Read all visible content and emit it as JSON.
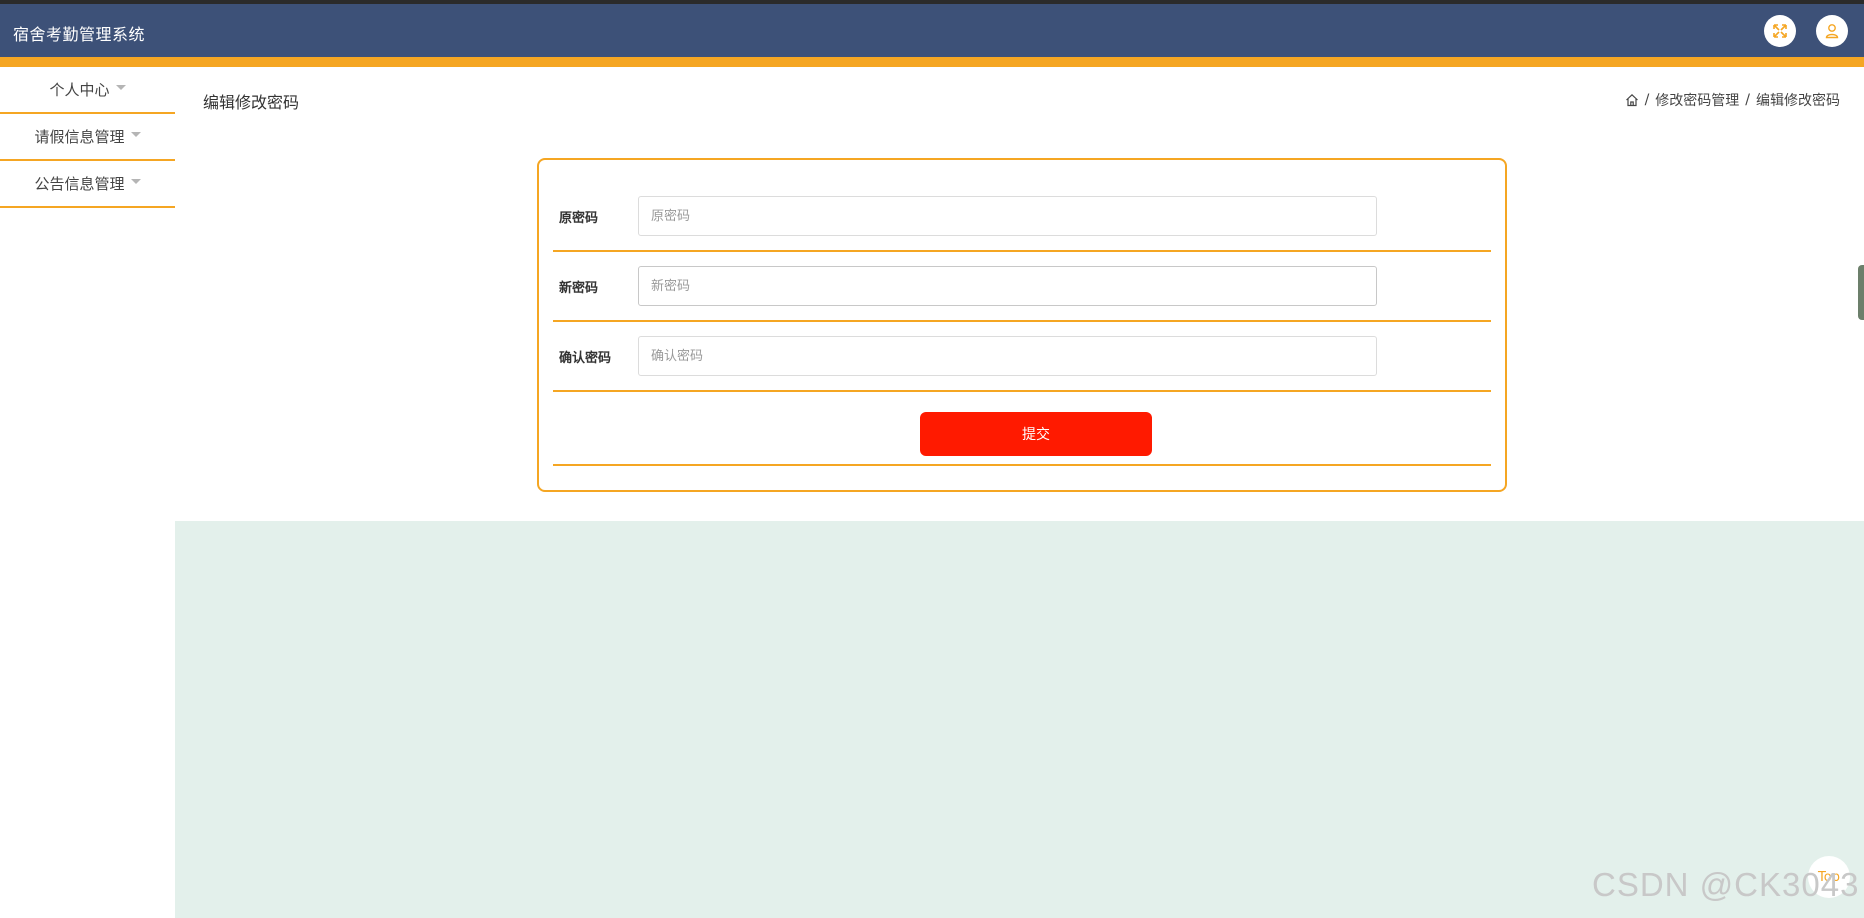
{
  "app": {
    "title": "宿舍考勤管理系统"
  },
  "header": {
    "fullscreen_icon": "expand-icon",
    "user_icon": "user-icon"
  },
  "colors": {
    "header_bg": "#3d5178",
    "accent": "#f5a623",
    "submit": "#ff1a00",
    "content_bg": "#e3f0eb"
  },
  "sidebar": {
    "items": [
      {
        "label": "个人中心"
      },
      {
        "label": "请假信息管理"
      },
      {
        "label": "公告信息管理"
      }
    ]
  },
  "page": {
    "title": "编辑修改密码",
    "breadcrumb": {
      "home_icon": "home-icon",
      "sep": "/",
      "level1": "修改密码管理",
      "level2": "编辑修改密码"
    }
  },
  "form": {
    "old_password": {
      "label": "原密码",
      "placeholder": "原密码",
      "value": ""
    },
    "new_password": {
      "label": "新密码",
      "placeholder": "新密码",
      "value": ""
    },
    "confirm_password": {
      "label": "确认密码",
      "placeholder": "确认密码",
      "value": ""
    },
    "submit_label": "提交"
  },
  "scroll_top_label": "Top",
  "watermark": "CSDN @CK3043"
}
